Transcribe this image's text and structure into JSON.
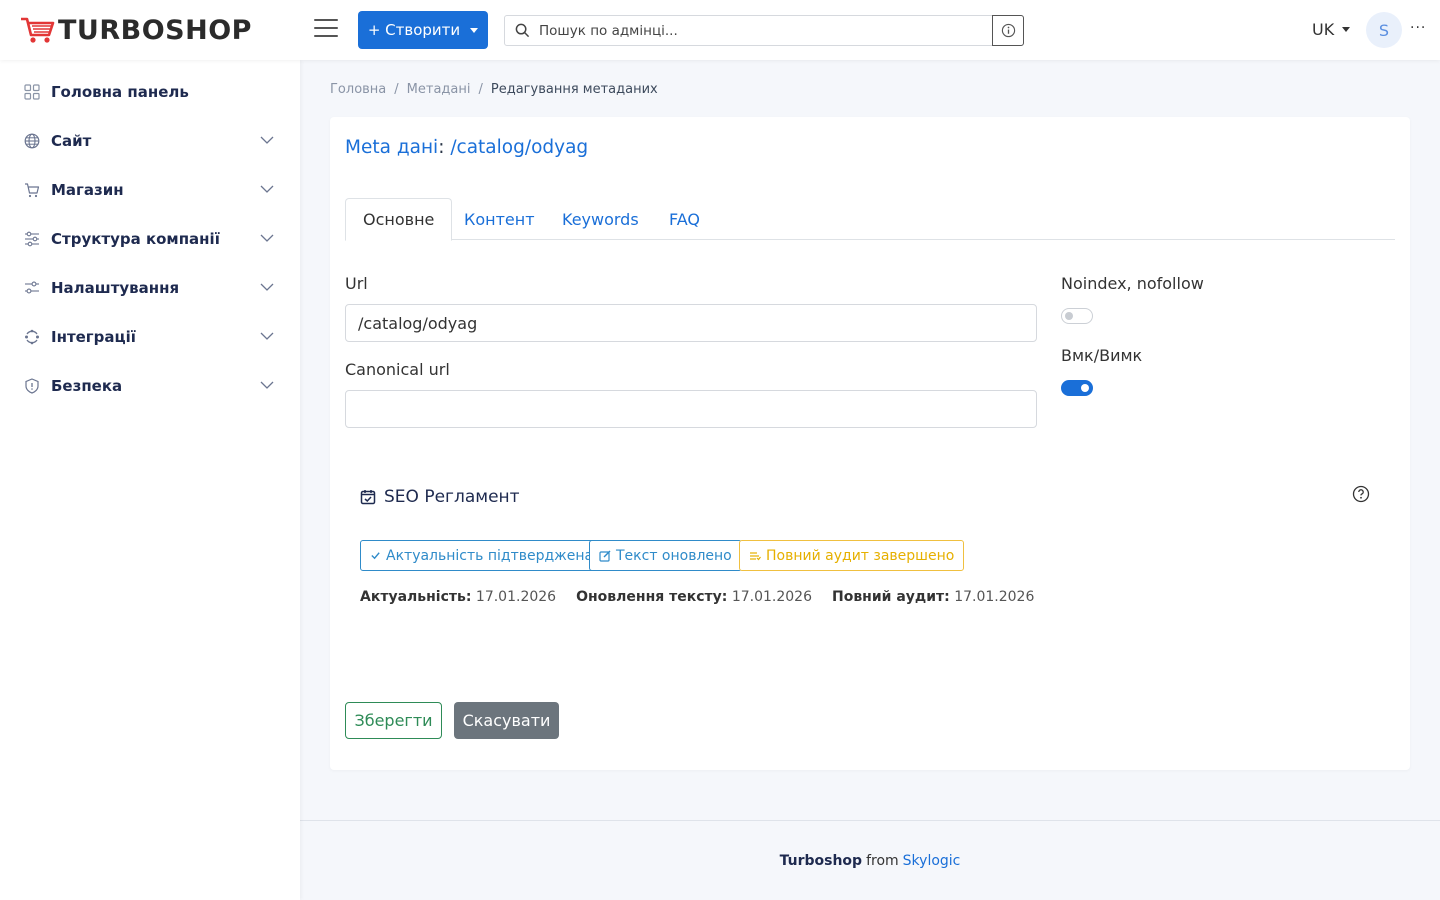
{
  "header": {
    "logo_text": "TURBOSHOP",
    "create_label": "+ Створити",
    "search_placeholder": "Пошук по адмінці...",
    "language": "UK",
    "avatar_letter": "S",
    "more_label": "···"
  },
  "sidebar": {
    "items": [
      {
        "label": "Головна панель",
        "icon": "dashboard-icon",
        "expandable": false
      },
      {
        "label": "Сайт",
        "icon": "globe-icon",
        "expandable": true
      },
      {
        "label": "Магазин",
        "icon": "cart-icon",
        "expandable": true
      },
      {
        "label": "Структура компанії",
        "icon": "sliders-icon",
        "expandable": true
      },
      {
        "label": "Налаштування",
        "icon": "settings-sliders-icon",
        "expandable": true
      },
      {
        "label": "Інтеграції",
        "icon": "integrations-icon",
        "expandable": true
      },
      {
        "label": "Безпека",
        "icon": "shield-icon",
        "expandable": true
      }
    ]
  },
  "breadcrumb": {
    "items": [
      "Головна",
      "Метадані"
    ],
    "separator": "/",
    "current": "Редагування метаданих"
  },
  "card": {
    "title_prefix": "Meta дані",
    "title_sep": ":",
    "title_value": "/catalog/odyag"
  },
  "tabs": [
    "Основне",
    "Контент",
    "Keywords",
    "FAQ"
  ],
  "active_tab": "Основне",
  "form": {
    "url_label": "Url",
    "url_value": "/catalog/odyag",
    "canonical_label": "Canonical url",
    "canonical_value": "",
    "noindex_label": "Noindex, nofollow",
    "noindex_on": false,
    "enabled_label": "Вмк/Вимк",
    "enabled_on": true
  },
  "seo": {
    "title": "SEO Регламент",
    "buttons": {
      "actuality": "Актуальність підтверджена",
      "text_updated": "Текст оновлено",
      "full_audit": "Повний аудит завершено"
    },
    "dates": {
      "actuality_label": "Актуальність:",
      "actuality_value": "17.01.2026",
      "text_label": "Оновлення тексту:",
      "text_value": "17.01.2026",
      "audit_label": "Повний аудит:",
      "audit_value": "17.01.2026"
    }
  },
  "actions": {
    "save": "Зберегти",
    "cancel": "Скасувати"
  },
  "footer": {
    "brand": "Turboshop",
    "from": "from",
    "company": "Skylogic"
  },
  "colors": {
    "primary": "#1a6fd8",
    "success": "#2e8b57",
    "info": "#2f8bc9",
    "warning": "#e6b000",
    "secondary": "#6c757d",
    "nav_text": "#1e2a4f",
    "logo_red": "#e23636"
  }
}
